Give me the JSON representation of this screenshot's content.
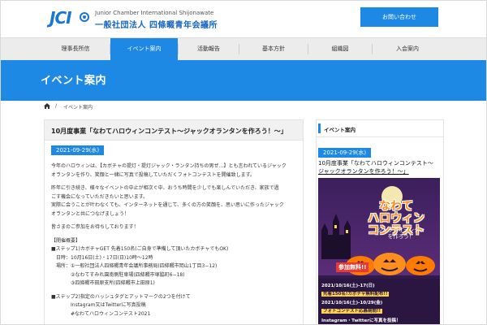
{
  "header": {
    "logo_mark": "JCI",
    "logo_en": "Junior Chamber International Shijonawate",
    "logo_jp": "一般社団法人 四條畷青年会議所",
    "contact_label": "お問い合わせ"
  },
  "nav": {
    "items": [
      {
        "label": "理事長所信"
      },
      {
        "label": "イベント案内"
      },
      {
        "label": "活動報告"
      },
      {
        "label": "基本方針"
      },
      {
        "label": "組織図"
      },
      {
        "label": "入会案内"
      }
    ],
    "active_index": 1
  },
  "banner": {
    "title": "イベント案内"
  },
  "breadcrumb": {
    "separator": "/",
    "current": "イベント案内"
  },
  "post": {
    "title": "10月度事業「なわてハロウィンコンテスト〜ジャックオランタンを作ろう！〜」",
    "date": "2021-09-29(水)",
    "lines": [
      "今年のハロウィンは、【カボチャの提灯・提灯ジャック・ランタン持ちの男ぜ…】とも言われているジャック",
      "オランタンを作り、笑顔と一緒に写真で投稿していただくフォトコンテストを開催致します。",
      "",
      "昨年に引き続き、様々なイベントの中止が相次ぐ中、おうち時間を少しでも楽しんでいただき、家族で過",
      "ごす機会になっていただきたいと思います。",
      "実際に会うことが叶わなくても、インターネットを通じて、多くの方の笑顔を、思い思いに作ったジャック",
      "オランタンと共につなげましょう！",
      "",
      "皆さまのご参加をお待ちしております！",
      "",
      "【開催概要】",
      "■ステップ1)カボチャGET 先着150名(ご自身で準備して頂いたカボチャでもOK)",
      "　日時：10月16日(土)・17日(日)10時〜12時",
      "　場所：①一般社団法人四條畷青年会議所事務局(四條畷市岡山1丁目3−12)",
      "　　　　②なわてすみれ園南側駐車場(四條畷市塚脇町6−18)",
      "　　　　③四條畷市田原支所(四條畷市上田原1)",
      "",
      "■ステップ2)指定のハッシュタグとアットマークの2つを付けて",
      "　　　　Instagram又はTwitterに写真投稿",
      "　　　　#なわてハロウィンコンテスト2021"
    ]
  },
  "sidebar": {
    "heading": "イベント案内",
    "date": "2021-09-29(水)",
    "title_line1": "10月度事業「なわてハロウィンコンテスト〜",
    "title_line2": "ジャックオランタンを作ろう！〜」",
    "poster": {
      "title_line1": "なわて",
      "title_line2": "ハロウィン",
      "title_line3": "コンテスト",
      "subtitle_line1": "ジャックオランタン",
      "subtitle_line2": "を作ろう！",
      "free_label": "参加無料!!",
      "info1": "2021/10/16(土)-17(日)",
      "info2": "先着150名!カボチャ無料配布!!",
      "info3": "2021/10/16(土)-10/29(金)",
      "info4": "フォトコンテスト応募期間!!",
      "info5": "Instagram・Twitterに写真を投稿！"
    }
  },
  "colors": {
    "primary": "#1e88e5",
    "nav_bg": "#ececec",
    "poster_orange": "#ff8a1c"
  },
  "icons": {
    "home": "home-icon"
  }
}
